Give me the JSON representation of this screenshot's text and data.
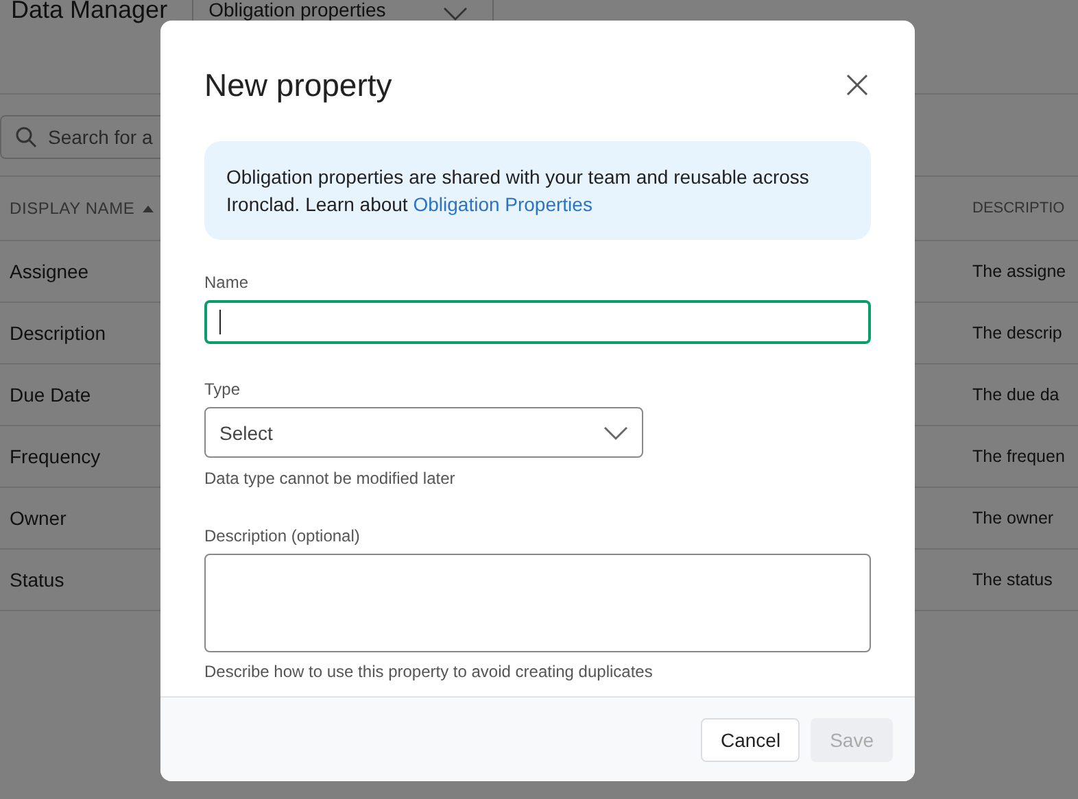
{
  "page": {
    "title": "Data Manager",
    "view_select": "Obligation properties",
    "search": {
      "placeholder": "Search for a"
    }
  },
  "table": {
    "columns": [
      {
        "label": "DISPLAY NAME",
        "sorted": true
      },
      {
        "label": "DESCRIPTIO"
      }
    ],
    "rows": [
      {
        "name": "Assignee",
        "description": "The assigne"
      },
      {
        "name": "Description",
        "description": "The descrip"
      },
      {
        "name": "Due Date",
        "description": "The due da"
      },
      {
        "name": "Frequency",
        "description": "The frequen"
      },
      {
        "name": "Owner",
        "description": "The owner"
      },
      {
        "name": "Status",
        "description": "The status"
      }
    ]
  },
  "dialog": {
    "title": "New property",
    "info": "Obligation properties are shared with your team and reusable across Ironclad. Learn about ",
    "info_link": "Obligation Properties",
    "fields": [
      {
        "kind": "text",
        "label": "Name",
        "focused": true
      },
      {
        "kind": "select",
        "label": "Type",
        "placeholder": "Select",
        "help": "Data type cannot be modified later"
      },
      {
        "kind": "textarea",
        "label": "Description (optional)",
        "help": "Describe how to use this property to avoid creating duplicates"
      }
    ],
    "buttons": [
      {
        "label": "Cancel",
        "disabled": false
      },
      {
        "label": "Save",
        "disabled": true
      }
    ]
  }
}
